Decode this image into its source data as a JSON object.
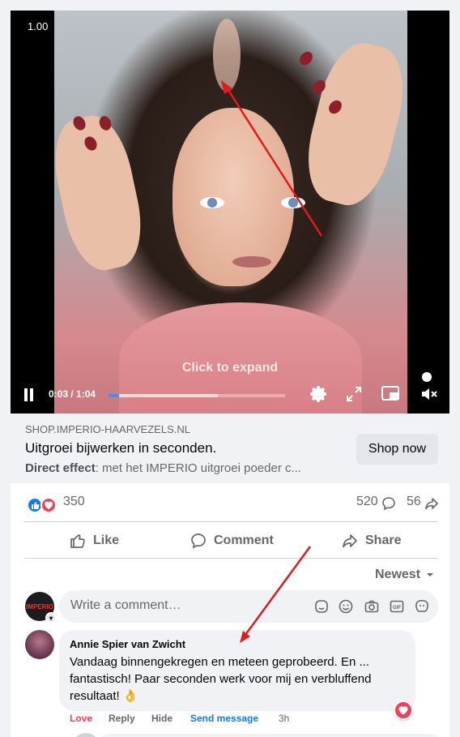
{
  "video": {
    "speed": "1.00",
    "overlay_text": "Click to expand",
    "time": "0:03 / 1:04",
    "progress": 0.06,
    "buffered": 0.62,
    "controls": [
      "pause-icon",
      "settings-icon",
      "expand-icon",
      "picture-in-picture-icon",
      "mute-icon"
    ]
  },
  "link": {
    "domain": "SHOP.IMPERIO-HAARVEZELS.NL",
    "headline": "Uitgroei bijwerken in seconden.",
    "desc_bold": "Direct effect",
    "desc_rest": ": met het IMPERIO uitgroei poeder c...",
    "cta": "Shop now"
  },
  "stats": {
    "reactions": "350",
    "comments": "520",
    "shares": "56"
  },
  "actions": {
    "like": "Like",
    "comment": "Comment",
    "share": "Share"
  },
  "comments_section": {
    "sort": "Newest",
    "composer_placeholder": "Write a comment…",
    "page_avatar_text": "IMPERIO",
    "composer_icons": [
      "sticker-icon",
      "emoji-icon",
      "camera-icon",
      "gif-icon",
      "avatar-sticker-icon"
    ]
  },
  "comment": {
    "author": "Annie Spier van Zwicht",
    "text": "Vandaag binnengekregen en meteen geprobeerd. En ... fantastisch! Paar seconden werk voor mij en verbluffend resultaat! 👌",
    "love": "Love",
    "reply": "Reply",
    "hide": "Hide",
    "send_message": "Send message",
    "time": "3h"
  },
  "colors": {
    "accent": "#1877f2",
    "love": "#f33e58",
    "annotation_arrow": "#e01b1b",
    "background": "#f0f2f5"
  }
}
